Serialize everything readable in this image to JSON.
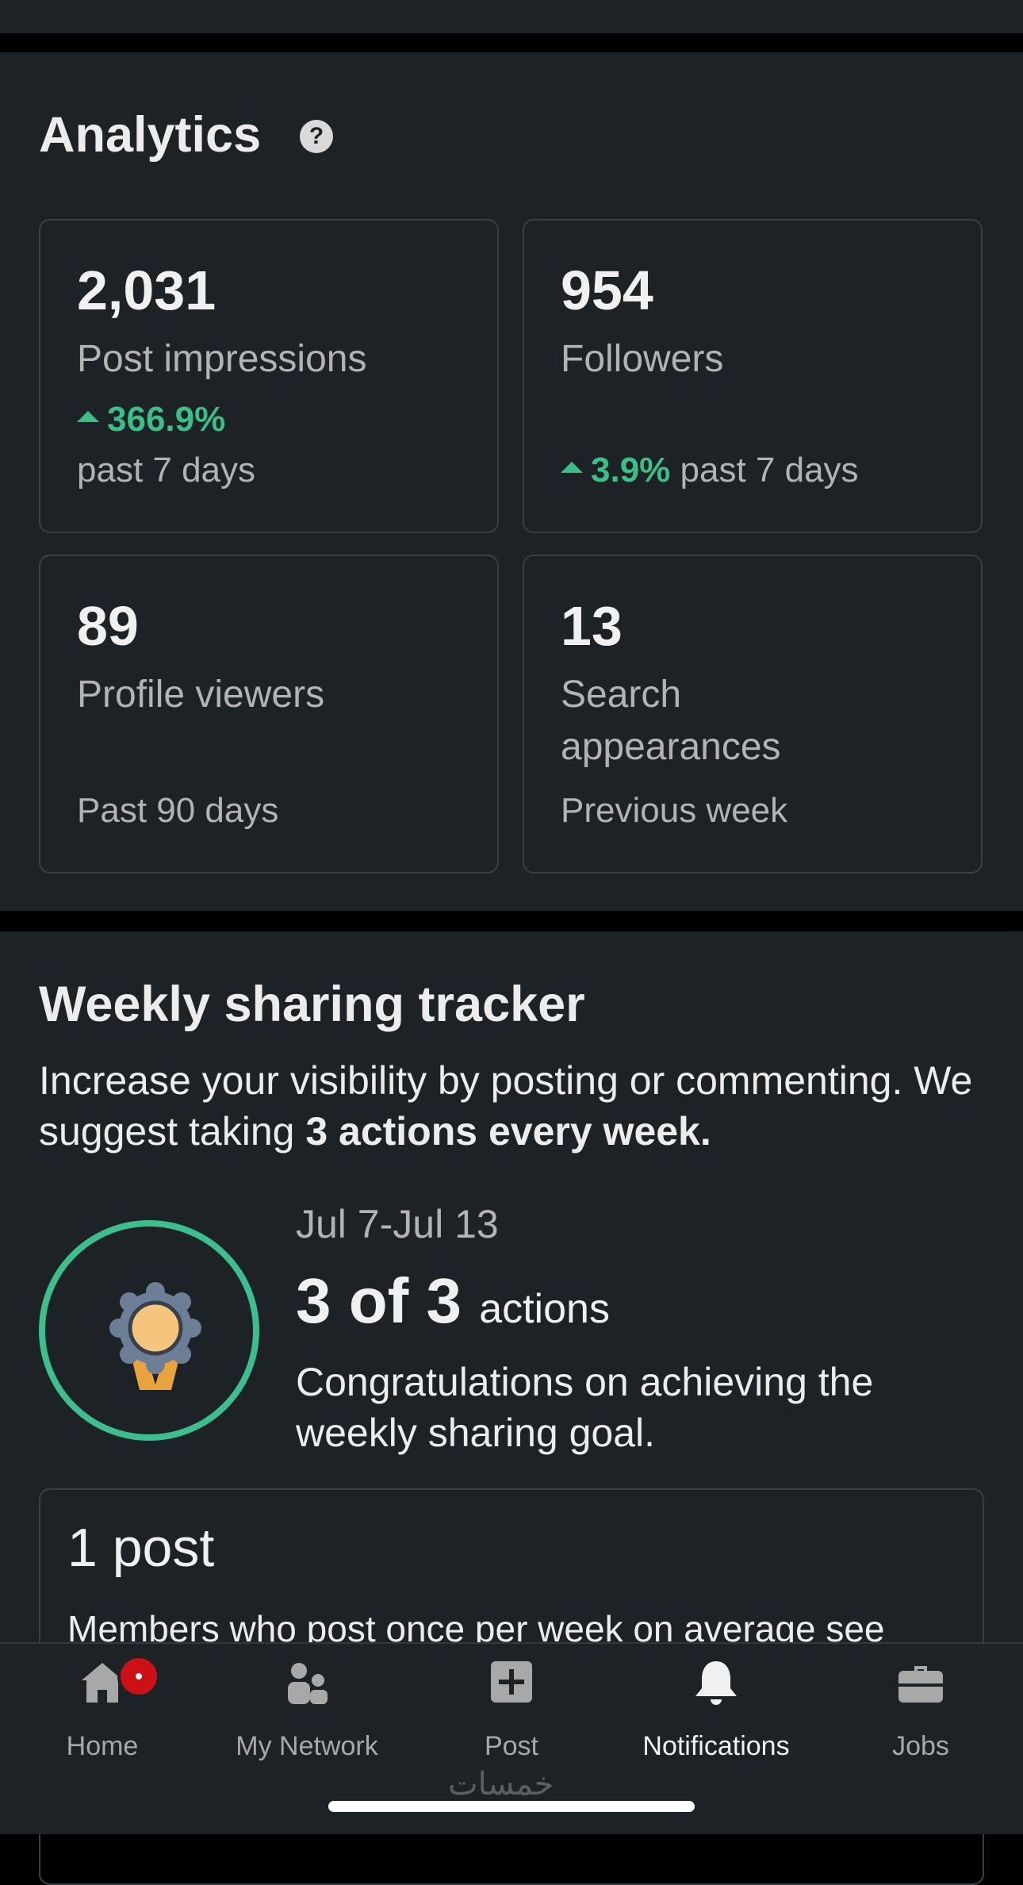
{
  "analytics": {
    "title": "Analytics",
    "help_icon": "question-circle-icon",
    "cards": [
      {
        "value": "2,031",
        "label": "Post impressions",
        "change": "366.9%",
        "period": "past 7 days"
      },
      {
        "value": "954",
        "label": "Followers",
        "change": "3.9%",
        "period": "past 7 days"
      },
      {
        "value": "89",
        "label": "Profile viewers",
        "period": "Past 90 days"
      },
      {
        "value": "13",
        "label": "Search appearances",
        "period": "Previous week"
      }
    ]
  },
  "tracker": {
    "title": "Weekly sharing tracker",
    "desc_prefix": "Increase your visibility by posting or commenting. We suggest taking ",
    "desc_bold": "3 actions every week.",
    "date_range": "Jul 7-Jul 13",
    "progress_big": "3 of 3",
    "progress_unit": "actions",
    "congrats": "Congratulations on achieving the weekly sharing goal.",
    "badge_icon": "award-ribbon-icon",
    "post_card": {
      "title": "1 post",
      "desc_before": "Members who post once per we",
      "desc_link": "ek on avera",
      "desc_after": "ge see"
    }
  },
  "nav": {
    "items": [
      {
        "label": "Home",
        "icon": "home-icon"
      },
      {
        "label": "My Network",
        "icon": "network-icon"
      },
      {
        "label": "Post",
        "icon": "plus-square-icon"
      },
      {
        "label": "Notifications",
        "icon": "bell-icon"
      },
      {
        "label": "Jobs",
        "icon": "briefcase-icon"
      }
    ],
    "active": "Notifications"
  },
  "watermark": "خمسات",
  "colors": {
    "background": "#1d2226",
    "accent_green": "#3dbe86",
    "badge_red": "#cc1016"
  }
}
